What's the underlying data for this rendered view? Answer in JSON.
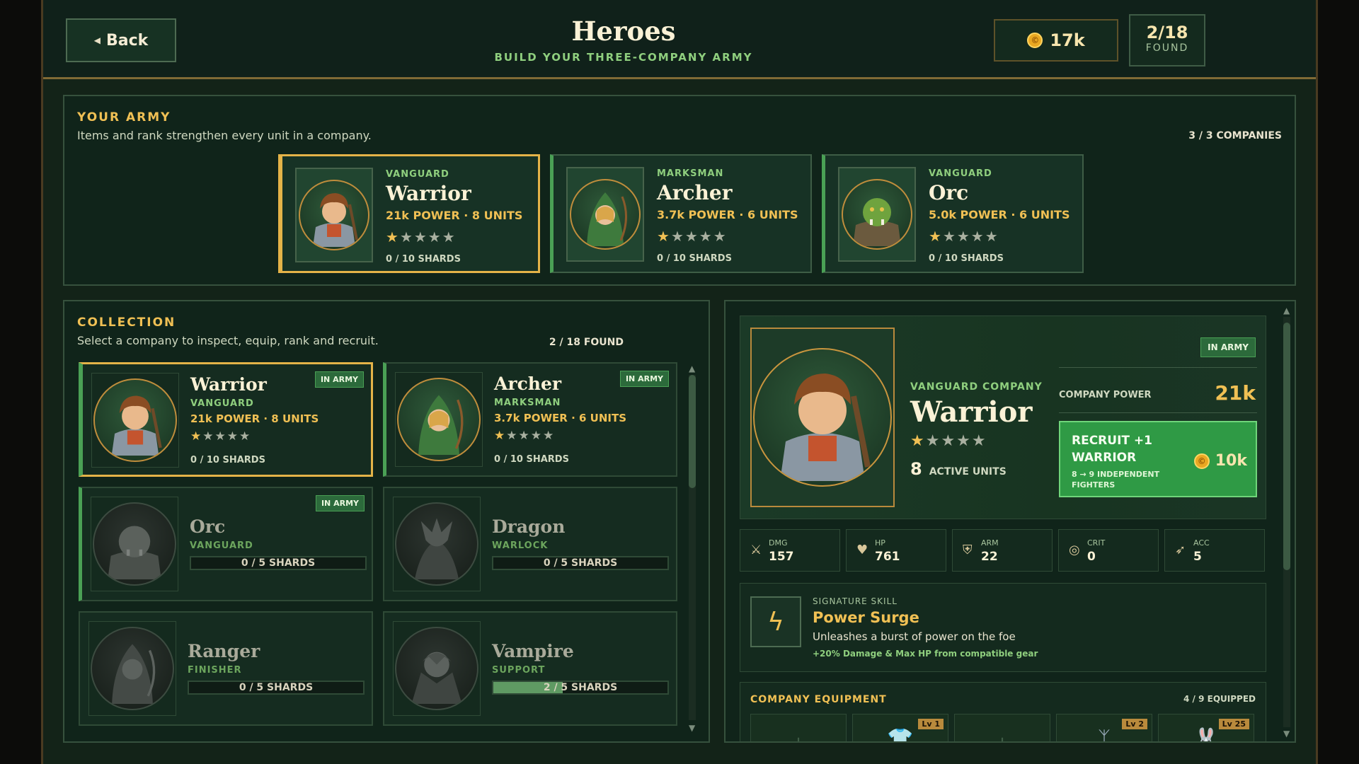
{
  "header": {
    "back_label": "Back",
    "title": "Heroes",
    "subtitle": "BUILD YOUR THREE-COMPANY ARMY",
    "coins": "17k",
    "found_value": "2/18",
    "found_label": "FOUND"
  },
  "army": {
    "title": "YOUR ARMY",
    "description": "Items and rank strengthen every unit in a company.",
    "count": "3 / 3 COMPANIES",
    "cards": [
      {
        "role": "VANGUARD",
        "name": "Warrior",
        "power": "21k POWER · 8 UNITS",
        "stars_filled": 1,
        "stars_total": 5,
        "shards": "0 / 10 SHARDS",
        "icon": "warrior-portrait"
      },
      {
        "role": "MARKSMAN",
        "name": "Archer",
        "power": "3.7k POWER · 6 UNITS",
        "stars_filled": 1,
        "stars_total": 5,
        "shards": "0 / 10 SHARDS",
        "icon": "archer-portrait"
      },
      {
        "role": "VANGUARD",
        "name": "Orc",
        "power": "5.0k POWER · 6 UNITS",
        "stars_filled": 1,
        "stars_total": 5,
        "shards": "0 / 10 SHARDS",
        "icon": "orc-portrait"
      }
    ]
  },
  "collection": {
    "title": "COLLECTION",
    "description": "Select a company to inspect, equip, rank and recruit.",
    "count": "2 / 18 FOUND",
    "badge": "IN ARMY",
    "cards": [
      {
        "name": "Warrior",
        "role": "VANGUARD",
        "power": "21k POWER · 8 UNITS",
        "shards": "0 / 10 SHARDS",
        "in_army": true
      },
      {
        "name": "Archer",
        "role": "MARKSMAN",
        "power": "3.7k POWER · 6 UNITS",
        "shards": "0 / 10 SHARDS",
        "in_army": true
      },
      {
        "name": "Orc",
        "role": "VANGUARD",
        "shards": "0 / 5 SHARDS",
        "shard_progress": 0,
        "in_army": true
      },
      {
        "name": "Dragon",
        "role": "WARLOCK",
        "shards": "0 / 5 SHARDS",
        "shard_progress": 0,
        "in_army": false
      },
      {
        "name": "Ranger",
        "role": "FINISHER",
        "shards": "0 / 5 SHARDS",
        "shard_progress": 0,
        "in_army": false
      },
      {
        "name": "Vampire",
        "role": "SUPPORT",
        "shards": "2 / 5 SHARDS",
        "shard_progress": 0.4,
        "in_army": false
      }
    ]
  },
  "detail": {
    "badge": "IN ARMY",
    "role": "VANGUARD COMPANY",
    "name": "Warrior",
    "stars_filled": 1,
    "units_value": "8",
    "units_label": "ACTIVE UNITS",
    "power_label": "COMPANY POWER",
    "power_value": "21k",
    "recruit_title": "RECRUIT +1 WARRIOR",
    "recruit_sub": "8 → 9 INDEPENDENT FIGHTERS",
    "recruit_cost": "10k",
    "stats": [
      {
        "label": "DMG",
        "value": "157",
        "icon": "sword-icon"
      },
      {
        "label": "HP",
        "value": "761",
        "icon": "heart-icon"
      },
      {
        "label": "ARM",
        "value": "22",
        "icon": "shield-icon"
      },
      {
        "label": "CRIT",
        "value": "0",
        "icon": "crit-icon"
      },
      {
        "label": "ACC",
        "value": "5",
        "icon": "accuracy-icon"
      }
    ],
    "skill": {
      "label": "SIGNATURE SKILL",
      "name": "Power Surge",
      "description": "Unleashes a burst of power on the foe",
      "bonus": "+20% Damage & Max HP from compatible gear"
    },
    "equipment": {
      "title": "COMPANY EQUIPMENT",
      "count": "4 / 9 EQUIPPED",
      "slots": [
        {
          "empty": true
        },
        {
          "empty": false,
          "level": "Lv 1",
          "icon": "chainmail-icon"
        },
        {
          "empty": true
        },
        {
          "empty": false,
          "level": "Lv 2",
          "icon": "amulet-icon"
        },
        {
          "empty": false,
          "level": "Lv 25",
          "icon": "bunny-icon"
        }
      ]
    }
  },
  "colors": {
    "accent_gold": "#f0c054",
    "accent_green": "#4aa055",
    "recruit_green": "#2f9a45"
  }
}
